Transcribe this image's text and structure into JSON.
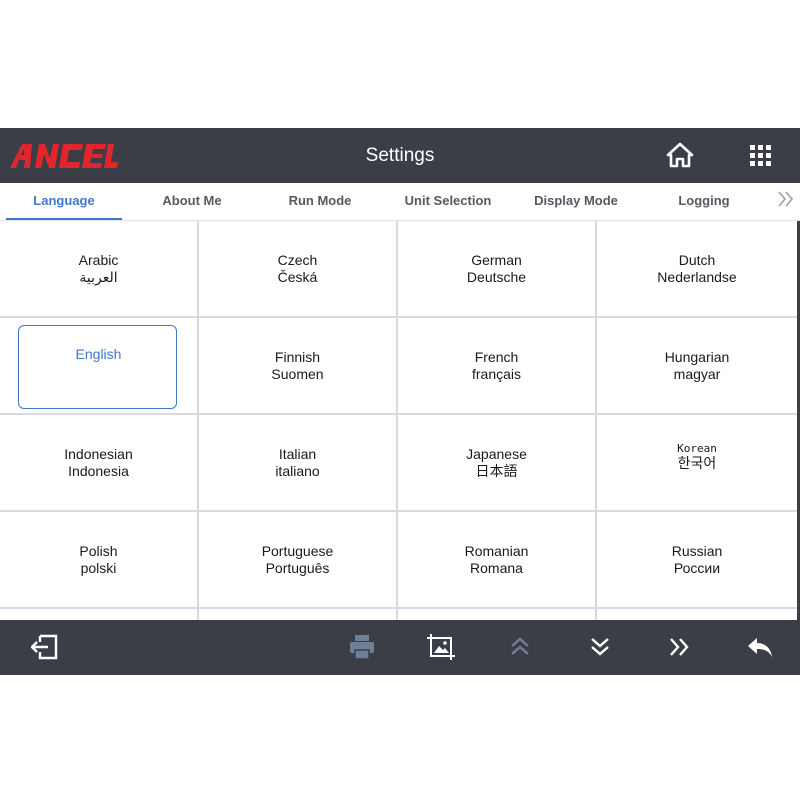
{
  "brand": {
    "name": "ANCEL",
    "accent": "#e0262c"
  },
  "header": {
    "title": "Settings",
    "home_icon": "home-icon",
    "apps_icon": "grid-menu-icon"
  },
  "tabs": [
    {
      "label": "Language",
      "active": true
    },
    {
      "label": "About Me",
      "active": false
    },
    {
      "label": "Run Mode",
      "active": false
    },
    {
      "label": "Unit Selection",
      "active": false
    },
    {
      "label": "Display Mode",
      "active": false
    },
    {
      "label": "Logging",
      "active": false
    }
  ],
  "languages": [
    {
      "name": "Arabic",
      "native": "العربية"
    },
    {
      "name": "Czech",
      "native": "Česká"
    },
    {
      "name": "German",
      "native": "Deutsche"
    },
    {
      "name": "Dutch",
      "native": "Nederlandse"
    },
    {
      "name": "English",
      "native": "",
      "selected": true
    },
    {
      "name": "Finnish",
      "native": "Suomen"
    },
    {
      "name": "French",
      "native": "français"
    },
    {
      "name": "Hungarian",
      "native": "magyar"
    },
    {
      "name": "Indonesian",
      "native": "Indonesia"
    },
    {
      "name": "Italian",
      "native": "italiano"
    },
    {
      "name": "Japanese",
      "native": "日本語"
    },
    {
      "name": "Korean",
      "native": "한국어"
    },
    {
      "name": "Polish",
      "native": "polski"
    },
    {
      "name": "Portuguese",
      "native": "Português"
    },
    {
      "name": "Romanian",
      "native": "Romana"
    },
    {
      "name": "Russian",
      "native": "России"
    }
  ],
  "footer": {
    "icons": [
      "exit-icon",
      "print-icon",
      "screenshot-icon",
      "page-up-icon",
      "page-down-icon",
      "fast-forward-icon",
      "back-icon"
    ]
  },
  "colors": {
    "bar": "#3b3e46",
    "accent": "#3f78c9",
    "disabled": "#6e7f99"
  }
}
